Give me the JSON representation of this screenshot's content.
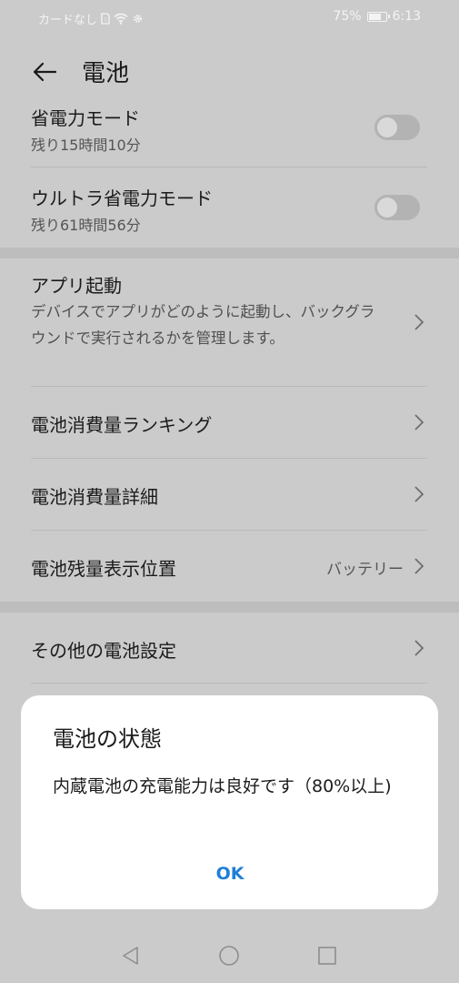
{
  "status_bar": {
    "carrier": "カードなし",
    "battery_percent": "75%",
    "battery_level": 0.75,
    "time": "6:13",
    "icons": [
      "sim-icon",
      "wifi-icon",
      "settings-gear-icon",
      "battery-icon"
    ]
  },
  "header": {
    "title": "電池",
    "back_icon": "arrow-left-icon"
  },
  "power_saving": {
    "title": "省電力モード",
    "subtitle": "残り15時間10分",
    "enabled": false
  },
  "ultra_power_saving": {
    "title": "ウルトラ省電力モード",
    "subtitle": "残り61時間56分",
    "enabled": false
  },
  "app_launch": {
    "title": "アプリ起動",
    "description": "デバイスでアプリがどのように起動し、バックグラウンドで実行されるかを管理します。"
  },
  "consumption_ranking": {
    "title": "電池消費量ランキング"
  },
  "consumption_details": {
    "title": "電池消費量詳細"
  },
  "battery_display": {
    "title": "電池残量表示位置",
    "value": "バッテリー"
  },
  "other_settings": {
    "title": "その他の電池設定"
  },
  "dialog": {
    "title": "電池の状態",
    "message": "内蔵電池の充電能力は良好です（80%以上)",
    "ok_label": "OK"
  },
  "nav_bar": {
    "icons": [
      "nav-back-icon",
      "nav-home-icon",
      "nav-recents-icon"
    ]
  },
  "colors": {
    "dim_background": "#cbcbcb",
    "dialog_background": "#ffffff",
    "accent": "#1f7fd6"
  }
}
